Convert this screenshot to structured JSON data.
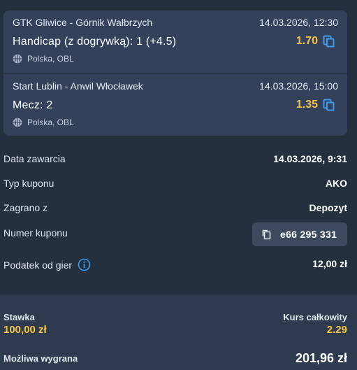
{
  "bets": [
    {
      "teams": "GTK Gliwice - Górnik Wałbrzych",
      "date": "14.03.2026, 12:30",
      "market": "Handicap (z dogrywką): 1 (+4.5)",
      "odds": "1.70",
      "league": "Polska, OBL",
      "sport_icon": "basketball-icon",
      "action_icon": "copy-icon"
    },
    {
      "teams": "Start Lublin - Anwil Włocławek",
      "date": "14.03.2026, 15:00",
      "market": "Mecz: 2",
      "odds": "1.35",
      "league": "Polska, OBL",
      "sport_icon": "basketball-icon",
      "action_icon": "copy-icon"
    }
  ],
  "details": {
    "date_label": "Data zawarcia",
    "date_value": "14.03.2026, 9:31",
    "type_label": "Typ kuponu",
    "type_value": "AKO",
    "played_label": "Zagrano z",
    "played_value": "Depozyt",
    "number_label": "Numer kuponu",
    "number_value": "e66 295 331",
    "tax_label": "Podatek od gier",
    "tax_value": "12,00 zł"
  },
  "summary": {
    "stake_label": "Stawka",
    "stake_value": "100,00 zł",
    "total_odds_label": "Kurs całkowity",
    "total_odds_value": "2.29",
    "win_label": "Możliwa wygrana",
    "win_value": "201,96 zł"
  },
  "colors": {
    "background": "#25303f",
    "card": "#34415a",
    "accent_odds": "#f6c443",
    "icon_blue": "#3b9cf0"
  }
}
